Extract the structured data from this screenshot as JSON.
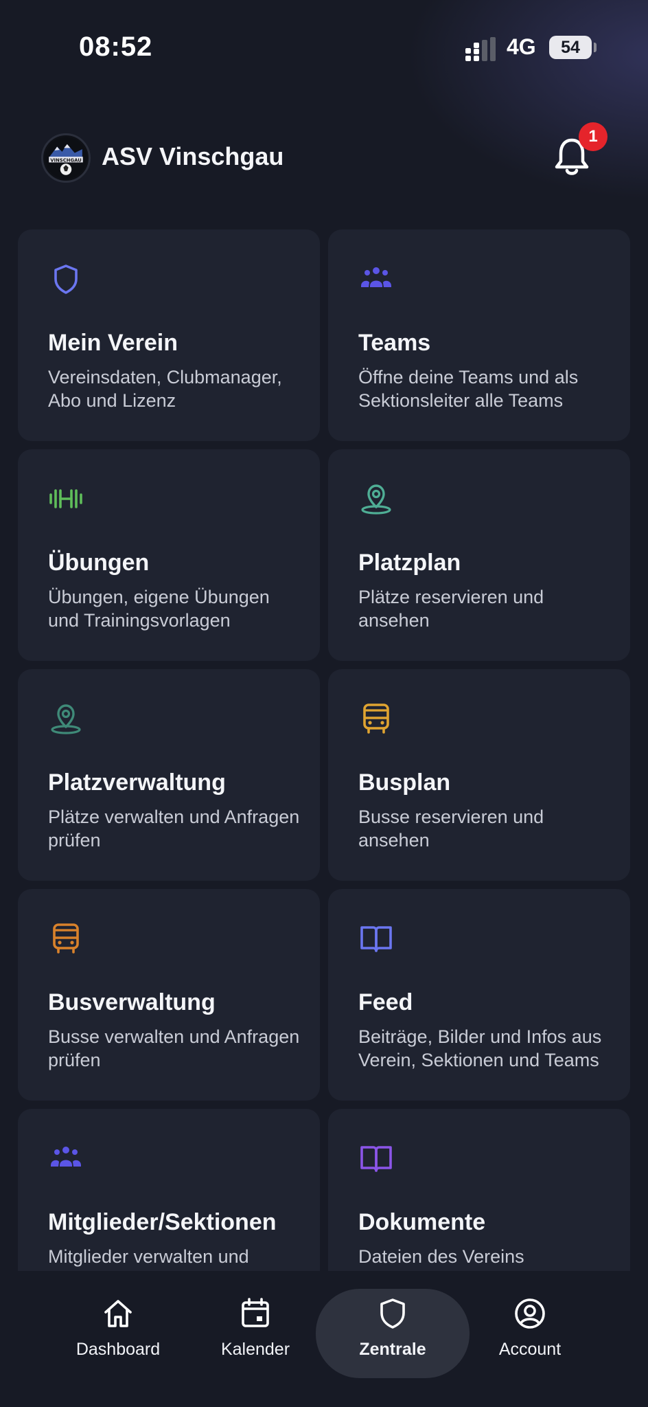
{
  "status_bar": {
    "time": "08:52",
    "network": "4G",
    "battery": "54"
  },
  "header": {
    "club_name": "ASV Vinschgau",
    "logo_text": "VINSCHGAU",
    "notification_count": "1"
  },
  "cards": [
    {
      "title": "Mein Verein",
      "desc": "Vereinsdaten, Clubmanager, Abo und Lizenz",
      "icon": "shield-icon",
      "color": "#6b76f0"
    },
    {
      "title": "Teams",
      "desc": "Öffne deine Teams und als Sektionsleiter alle Teams",
      "icon": "users-icon",
      "color": "#5b55e6"
    },
    {
      "title": "Übungen",
      "desc": "Übungen, eigene Übungen und Trainingsvorlagen",
      "icon": "dumbbell-icon",
      "color": "#5fbe5a"
    },
    {
      "title": "Platzplan",
      "desc": "Plätze reservieren und ansehen",
      "icon": "map-pin-icon",
      "color": "#4fae95"
    },
    {
      "title": "Platzverwaltung",
      "desc": "Plätze verwalten und Anfragen prüfen",
      "icon": "map-pin-icon",
      "color": "#3f8a78"
    },
    {
      "title": "Busplan",
      "desc": "Busse reservieren und ansehen",
      "icon": "bus-icon",
      "color": "#e0a431"
    },
    {
      "title": "Busverwaltung",
      "desc": "Busse verwalten und Anfragen prüfen",
      "icon": "bus-icon",
      "color": "#d9822b"
    },
    {
      "title": "Feed",
      "desc": "Beiträge, Bilder und Infos aus Verein, Sektionen und Teams",
      "icon": "book-icon",
      "color": "#6b76f0"
    },
    {
      "title": "Mitglieder/Sektionen",
      "desc": "Mitglieder  verwalten und Sektionen",
      "icon": "users-icon",
      "color": "#5b55e6"
    },
    {
      "title": "Dokumente",
      "desc": "Dateien des Vereins",
      "icon": "book-icon",
      "color": "#8b55e8"
    }
  ],
  "nav": [
    {
      "label": "Dashboard",
      "icon": "home-icon"
    },
    {
      "label": "Kalender",
      "icon": "calendar-icon"
    },
    {
      "label": "Zentrale",
      "icon": "shield-icon"
    },
    {
      "label": "Account",
      "icon": "user-circle-icon"
    }
  ]
}
